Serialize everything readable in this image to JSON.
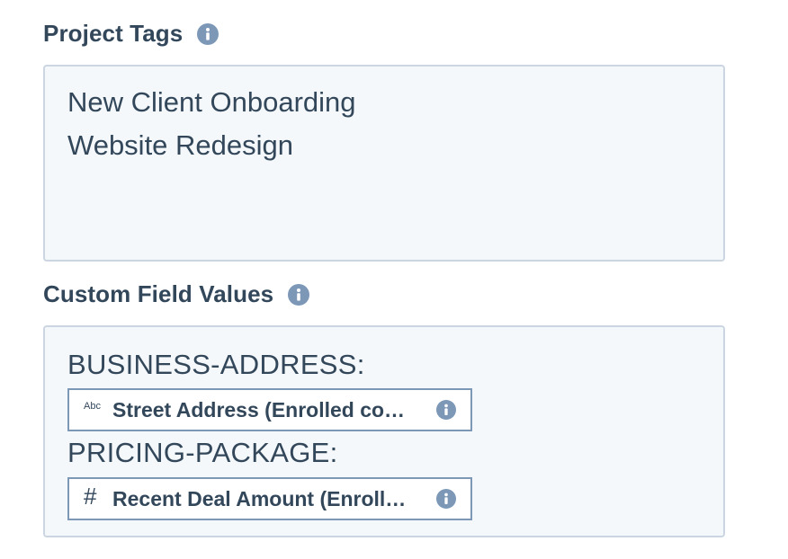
{
  "project_tags": {
    "label": "Project Tags",
    "info_icon": "info-icon",
    "lines": [
      "New Client Onboarding",
      "Website Redesign"
    ]
  },
  "custom_field_values": {
    "label": "Custom Field Values",
    "info_icon": "info-icon",
    "entries": [
      {
        "key": "BUSINESS-ADDRESS:",
        "token_type_icon": "text-type-icon",
        "token_type_glyph": "Abc",
        "token_label": "Street Address (Enrolled co…"
      },
      {
        "key": "PRICING-PACKAGE:",
        "token_type_icon": "number-type-icon",
        "token_type_glyph": "#",
        "token_label": "Recent Deal Amount (Enroll…"
      }
    ]
  },
  "colors": {
    "text": "#33475b",
    "field_bg": "#f5f8fa",
    "field_border": "#cbd6e2",
    "token_border": "#7c98b6",
    "info_icon_bg": "#7c98b6"
  }
}
